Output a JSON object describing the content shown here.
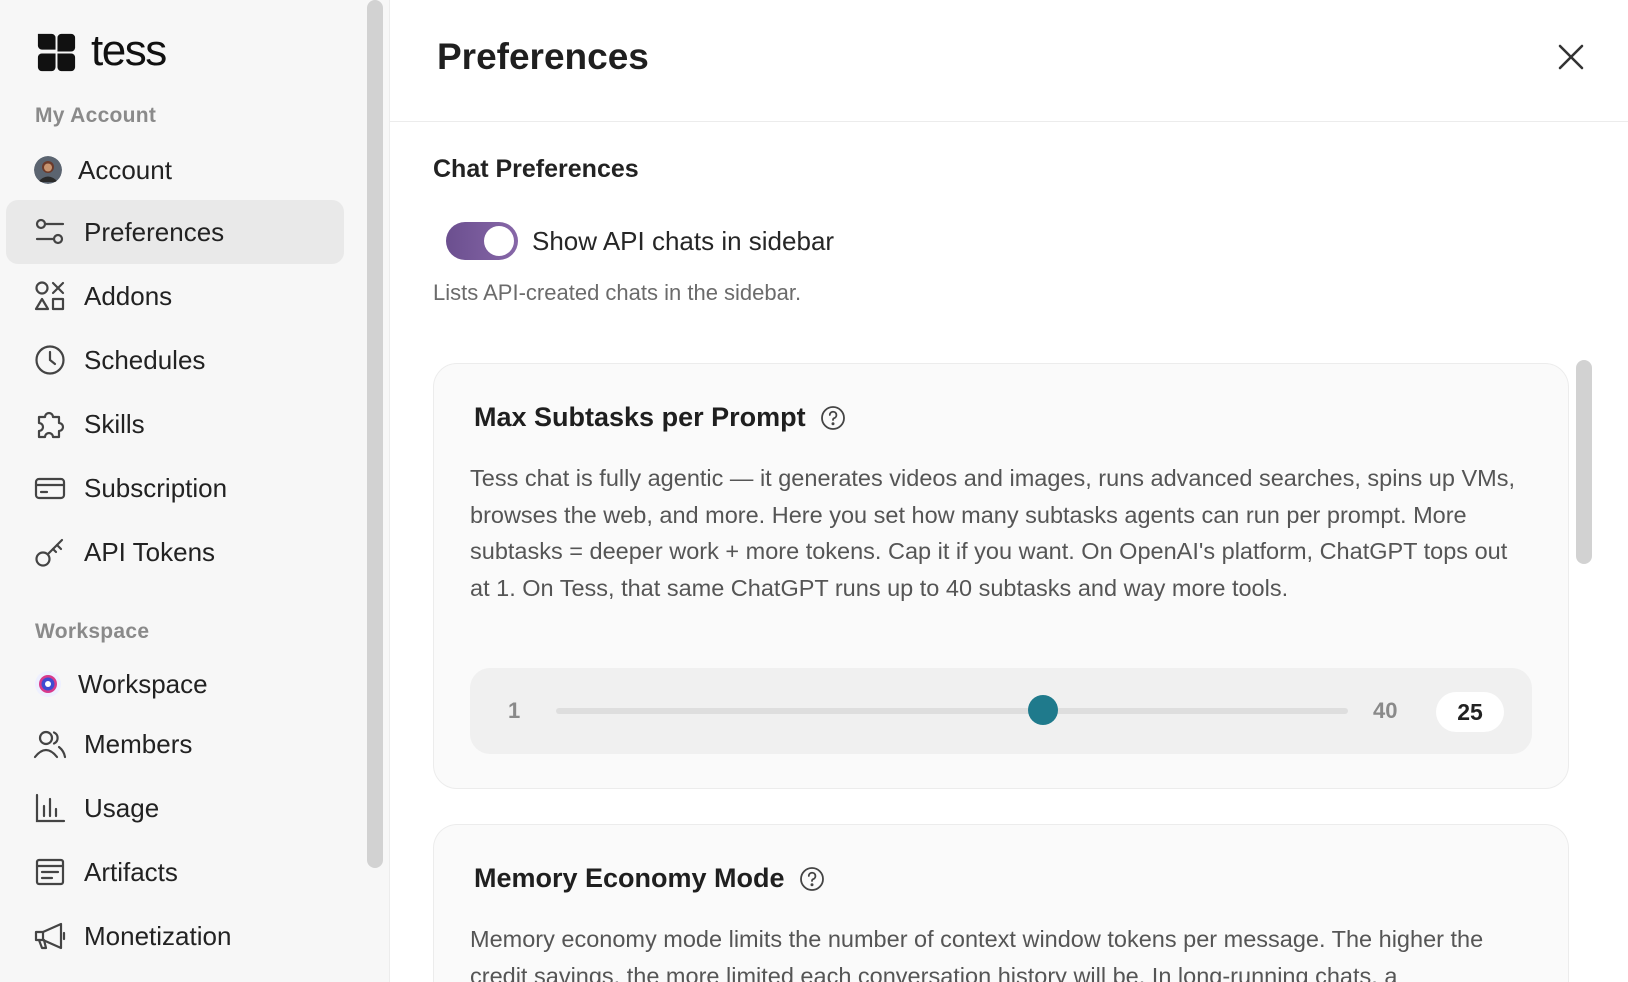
{
  "brand": {
    "name": "tess"
  },
  "sidebar": {
    "sections": [
      {
        "label": "My Account"
      },
      {
        "label": "Workspace"
      }
    ],
    "items": [
      {
        "label": "Account",
        "icon": "user-avatar"
      },
      {
        "label": "Preferences",
        "icon": "sliders-icon",
        "active": true
      },
      {
        "label": "Addons",
        "icon": "shapes-icon"
      },
      {
        "label": "Schedules",
        "icon": "clock-icon"
      },
      {
        "label": "Skills",
        "icon": "puzzle-icon"
      },
      {
        "label": "Subscription",
        "icon": "credit-card-icon"
      },
      {
        "label": "API Tokens",
        "icon": "key-icon"
      },
      {
        "label": "Workspace",
        "icon": "workspace-avatar"
      },
      {
        "label": "Members",
        "icon": "users-icon"
      },
      {
        "label": "Usage",
        "icon": "bar-chart-icon"
      },
      {
        "label": "Artifacts",
        "icon": "artifact-icon"
      },
      {
        "label": "Monetization",
        "icon": "megaphone-icon"
      }
    ]
  },
  "header": {
    "title": "Preferences"
  },
  "chat_preferences": {
    "title": "Chat Preferences",
    "toggle_label": "Show API chats in sidebar",
    "toggle_on": true,
    "toggle_desc": "Lists API-created chats in the sidebar."
  },
  "subtasks_card": {
    "title": "Max Subtasks per Prompt",
    "body": "Tess chat is fully agentic — it generates videos and images, runs advanced searches, spins up VMs, browses the web, and more. Here you set how many subtasks agents can run per prompt. More subtasks = deeper work + more tokens. Cap it if you want. On OpenAI's platform, ChatGPT tops out at 1. On Tess, that same ChatGPT runs up to 40 subtasks and way more tools.",
    "slider": {
      "min": 1,
      "max": 40,
      "value": 25,
      "min_label": "1",
      "max_label": "40",
      "value_label": "25"
    }
  },
  "memory_card": {
    "title": "Memory Economy Mode",
    "body": "Memory economy mode limits the number of context window tokens per message. The higher the credit savings, the more limited each conversation history will be. In long-running chats, a"
  },
  "colors": {
    "accent": "#1f7a8c",
    "toggle": "#7a5b9c",
    "active_bg": "#e9e9e9"
  }
}
